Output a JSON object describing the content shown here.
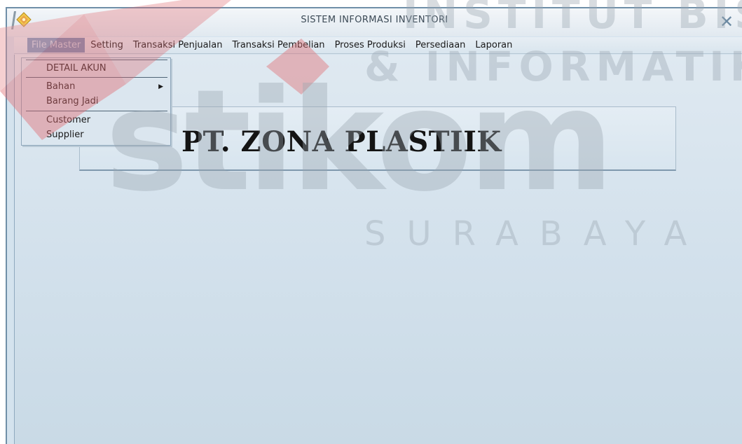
{
  "window": {
    "title": "SISTEM INFORMASI INVENTORI",
    "close_glyph": "✕",
    "icon": "app-logo-icon"
  },
  "menubar": {
    "items": [
      {
        "label": "File Master",
        "active": true
      },
      {
        "label": "Setting"
      },
      {
        "label": "Transaksi Penjualan"
      },
      {
        "label": "Transaksi Pembelian"
      },
      {
        "label": "Proses Produksi"
      },
      {
        "label": "Persediaan"
      },
      {
        "label": "Laporan"
      }
    ]
  },
  "file_master_menu": {
    "items": [
      {
        "label": "DETAIL AKUN"
      },
      {
        "label": "Bahan",
        "has_submenu": true,
        "arrow": "▶"
      },
      {
        "label": "Barang Jadi"
      },
      {
        "label": "Customer"
      },
      {
        "label": "Supplier"
      }
    ]
  },
  "banner": {
    "company_name": "PT. ZONA PLASTIIK"
  },
  "watermark": {
    "text_lines": [
      "INSTITUT BISNIS",
      "& INFORMATIKA",
      "stikom",
      "SURABAYA"
    ],
    "colors": {
      "red": "#e0686e",
      "gray": "#b9c2c9"
    }
  },
  "colors": {
    "menu_active_bg": "#6e93bb",
    "window_bg": "#d4e3ee"
  }
}
